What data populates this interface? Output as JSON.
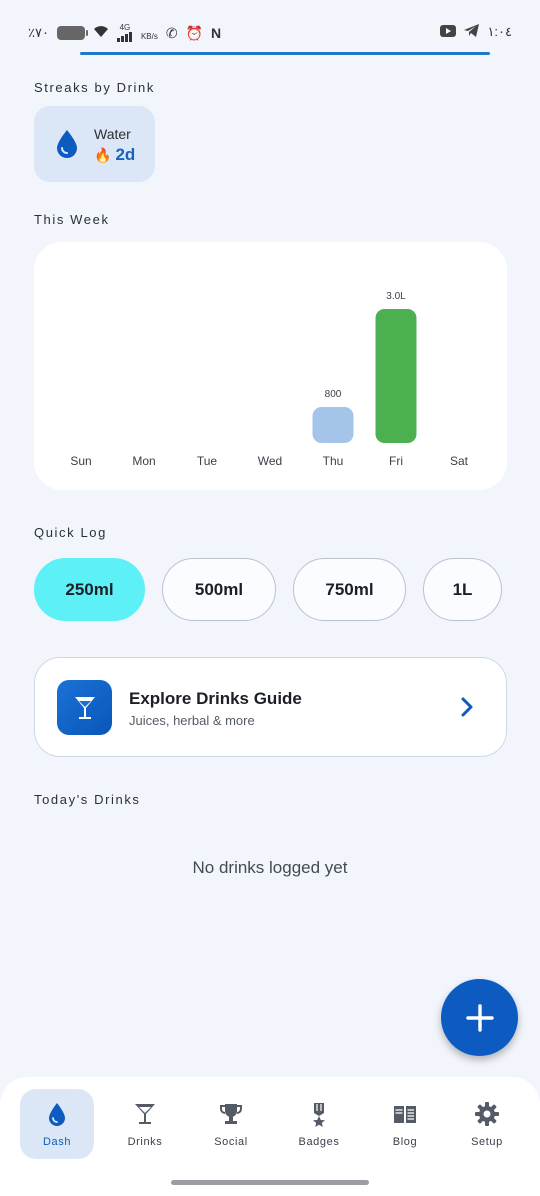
{
  "status_bar": {
    "battery_text": "٪٧٠",
    "network_label": "4G",
    "speed_label": "KB/s",
    "time": "١:٠٤"
  },
  "streaks": {
    "section_label": "Streaks by Drink",
    "items": [
      {
        "name": "Water",
        "value": "2d",
        "icon": "water-drop-icon"
      }
    ]
  },
  "week": {
    "section_label": "This Week"
  },
  "chart_data": {
    "type": "bar",
    "categories": [
      "Sun",
      "Mon",
      "Tue",
      "Wed",
      "Thu",
      "Fri",
      "Sat"
    ],
    "values": [
      0,
      0,
      0,
      0,
      800,
      3000
    ],
    "value_labels": [
      "",
      "",
      "",
      "",
      "800",
      "3.0L",
      ""
    ],
    "bar_colors": [
      "#a4c4ea",
      "#a4c4ea",
      "#a4c4ea",
      "#a4c4ea",
      "#a4c4ea",
      "#4caf50",
      "#a4c4ea"
    ],
    "title": "",
    "xlabel": "",
    "ylabel": "",
    "grid": false
  },
  "quick_log": {
    "section_label": "Quick Log",
    "options": [
      "250ml",
      "500ml",
      "750ml",
      "1L"
    ],
    "selected": "250ml"
  },
  "explore": {
    "title": "Explore Drinks Guide",
    "subtitle": "Juices, herbal & more",
    "icon": "cocktail-glass-icon"
  },
  "today": {
    "section_label": "Today's Drinks",
    "empty_text": "No drinks logged yet"
  },
  "fab": {
    "icon": "plus-icon"
  },
  "nav": {
    "items": [
      {
        "label": "Dash",
        "icon": "water-drop-icon",
        "active": true
      },
      {
        "label": "Drinks",
        "icon": "cocktail-glass-icon"
      },
      {
        "label": "Social",
        "icon": "trophy-icon"
      },
      {
        "label": "Badges",
        "icon": "medal-icon"
      },
      {
        "label": "Blog",
        "icon": "book-icon"
      },
      {
        "label": "Setup",
        "icon": "gear-icon"
      }
    ]
  },
  "colors": {
    "accent": "#0d5bc0",
    "background": "#f2f6fc",
    "selected_chip": "#5ef0f7",
    "streak_card": "#dbe7f6",
    "bar_low": "#a4c4ea",
    "bar_high": "#4caf50"
  }
}
